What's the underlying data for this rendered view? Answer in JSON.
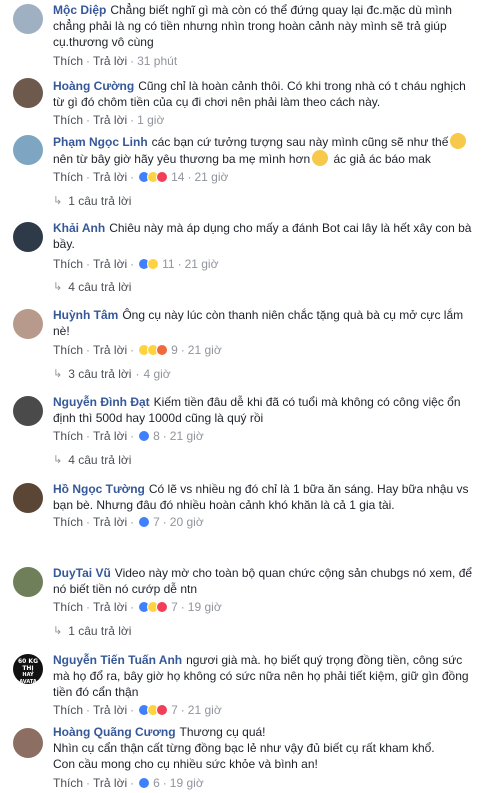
{
  "labels": {
    "like": "Thích",
    "reply": "Trả lời",
    "dot": "·"
  },
  "comments": [
    {
      "author": "Mộc Diệp",
      "lines": [
        "Chẳng biết nghĩ gì mà còn có thể đứng quay lại đc.mặc dù mình",
        "chẳng phải là ng có tiền nhưng nhìn trong hoàn cảnh này mình sẽ trả giúp",
        "cụ.thương vô cùng"
      ],
      "time": "31 phút"
    },
    {
      "author": "Hoàng Cường",
      "lines": [
        "Cũng chỉ là hoàn cảnh thôi. Có khi trong nhà có t cháu nghịch",
        "từ gì đó chôm tiền của cụ đi chơi nên phải làm theo cách này."
      ],
      "time": "1 giờ"
    },
    {
      "author": "Phạm Ngọc Linh",
      "lines": [
        "các bạn cứ tưởng tượng sau này mình cũng sẽ như thế",
        "nên từ bây giờ hãy yêu thương ba mẹ mình hơn",
        "ác giả ác báo mak"
      ],
      "reactions": "14",
      "time": "21 giờ",
      "replies": "1 câu trả lời",
      "replies_time": ""
    },
    {
      "author": "Khải Anh",
      "lines": [
        "Chiêu này mà áp dụng cho mấy a đánh Bot cai lây là hết xây con bà",
        "bầy."
      ],
      "reactions": "11",
      "time": "21 giờ",
      "replies": "4 câu trả lời",
      "replies_time": ""
    },
    {
      "author": "Huỳnh Tâm",
      "lines": [
        "Ông cụ này lúc còn thanh niên chắc tặng quà bà cụ mở cực lắm",
        "nè!"
      ],
      "reactions": "9",
      "time": "21 giờ",
      "replies": "3 câu trả lời",
      "replies_time": "4 giờ"
    },
    {
      "author": "Nguyễn Đình Đạt",
      "lines": [
        "Kiếm tiền đâu dễ khi đã có tuổi mà không có công việc ổn",
        "định thì 500d hay 1000d cũng là quý rồi"
      ],
      "reactions": "8",
      "time": "21 giờ",
      "replies": "4 câu trả lời",
      "replies_time": ""
    },
    {
      "author": "Hồ Ngọc Tường",
      "lines": [
        "Có lẽ vs nhiều ng đó chỉ là 1 bữa ăn sáng. Hay bữa nhậu vs",
        "bạn bè. Nhưng đâu đó nhiều hoàn cảnh khó khăn là cả 1 gia tài."
      ],
      "reactions": "7",
      "time": "20 giờ"
    },
    {
      "author": "DuyTai Vũ",
      "lines": [
        "Video này mờ cho toàn bộ quan chức cộng sản chubgs nó xem, để",
        "nó biết tiền nó cướp dễ ntn"
      ],
      "reactions": "7",
      "time": "19 giờ",
      "replies": "1 câu trả lời",
      "replies_time": ""
    },
    {
      "author": "Nguyễn Tiến Tuấn Anh",
      "lines": [
        "ngươi già mà. họ biết quý trọng đồng tiền, công sức",
        "mà họ đổ ra, bây giờ họ không có sức nữa nên họ phải tiết kiệm, giữ gìn đồng",
        "tiền đó cẩn thận"
      ],
      "reactions": "7",
      "time": "21 giờ"
    },
    {
      "author": "Hoàng Quãng Cương",
      "lines": [
        "Thương cụ quá!",
        "Nhìn cụ cẩn thận cất từng đồng bạc lẻ như vậy đủ biết cụ rất kham khổ.",
        "Con cầu mong cho cụ nhiều sức khỏe và bình an!"
      ],
      "reactions": "6",
      "time": "19 giờ"
    }
  ],
  "avatar_badge": {
    "line1": "60 KG",
    "line2": "THỊ",
    "line3": "HAY AVATA"
  }
}
